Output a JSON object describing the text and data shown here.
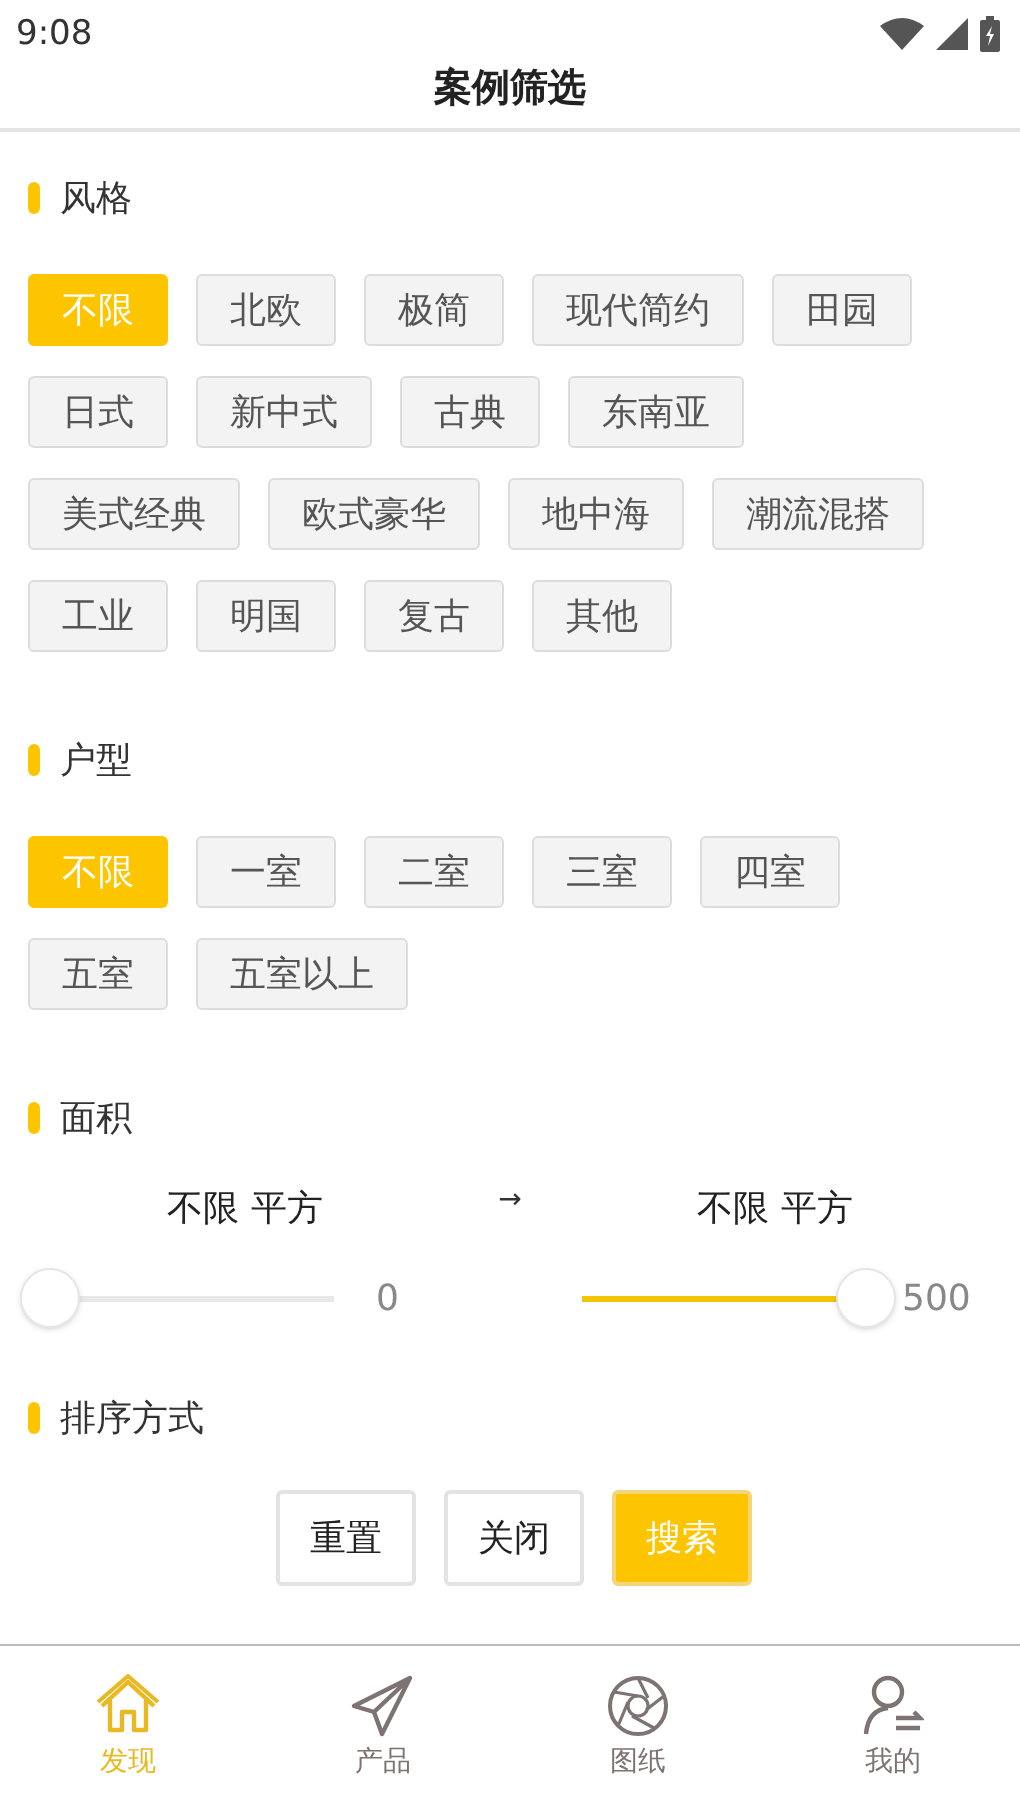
{
  "status_bar": {
    "time": "9:08"
  },
  "header": {
    "title": "案例筛选"
  },
  "sections": [
    {
      "title": "风格",
      "options": [
        {
          "label": "不限",
          "selected": true
        },
        {
          "label": "北欧",
          "selected": false
        },
        {
          "label": "极简",
          "selected": false
        },
        {
          "label": "现代简约",
          "selected": false
        },
        {
          "label": "田园",
          "selected": false
        },
        {
          "label": "日式",
          "selected": false
        },
        {
          "label": "新中式",
          "selected": false
        },
        {
          "label": "古典",
          "selected": false
        },
        {
          "label": "东南亚",
          "selected": false
        },
        {
          "label": "美式经典",
          "selected": false
        },
        {
          "label": "欧式豪华",
          "selected": false
        },
        {
          "label": "地中海",
          "selected": false
        },
        {
          "label": "潮流混搭",
          "selected": false
        },
        {
          "label": "工业",
          "selected": false
        },
        {
          "label": "明国",
          "selected": false
        },
        {
          "label": "复古",
          "selected": false
        },
        {
          "label": "其他",
          "selected": false
        }
      ]
    },
    {
      "title": "户型",
      "options": [
        {
          "label": "不限",
          "selected": true
        },
        {
          "label": "一室",
          "selected": false
        },
        {
          "label": "二室",
          "selected": false
        },
        {
          "label": "三室",
          "selected": false
        },
        {
          "label": "四室",
          "selected": false
        },
        {
          "label": "五室",
          "selected": false
        },
        {
          "label": "五室以上",
          "selected": false
        }
      ]
    }
  ],
  "area": {
    "title": "面积",
    "arrow": "→",
    "ranges": [
      {
        "label": "不限 平方",
        "level": 0,
        "reading": "0"
      },
      {
        "label": "不限 平方",
        "level": 1,
        "reading": "500"
      }
    ]
  },
  "sort": {
    "title": "排序方式"
  },
  "buttons": [
    {
      "label": "重置",
      "kind": "plain"
    },
    {
      "label": "关闭",
      "kind": "plain"
    },
    {
      "label": "搜索",
      "kind": "primary"
    }
  ],
  "nav": [
    {
      "label": "发现",
      "selected": true
    },
    {
      "label": "产品",
      "selected": false
    },
    {
      "label": "图纸",
      "selected": false
    },
    {
      "label": "我的",
      "selected": false
    }
  ]
}
